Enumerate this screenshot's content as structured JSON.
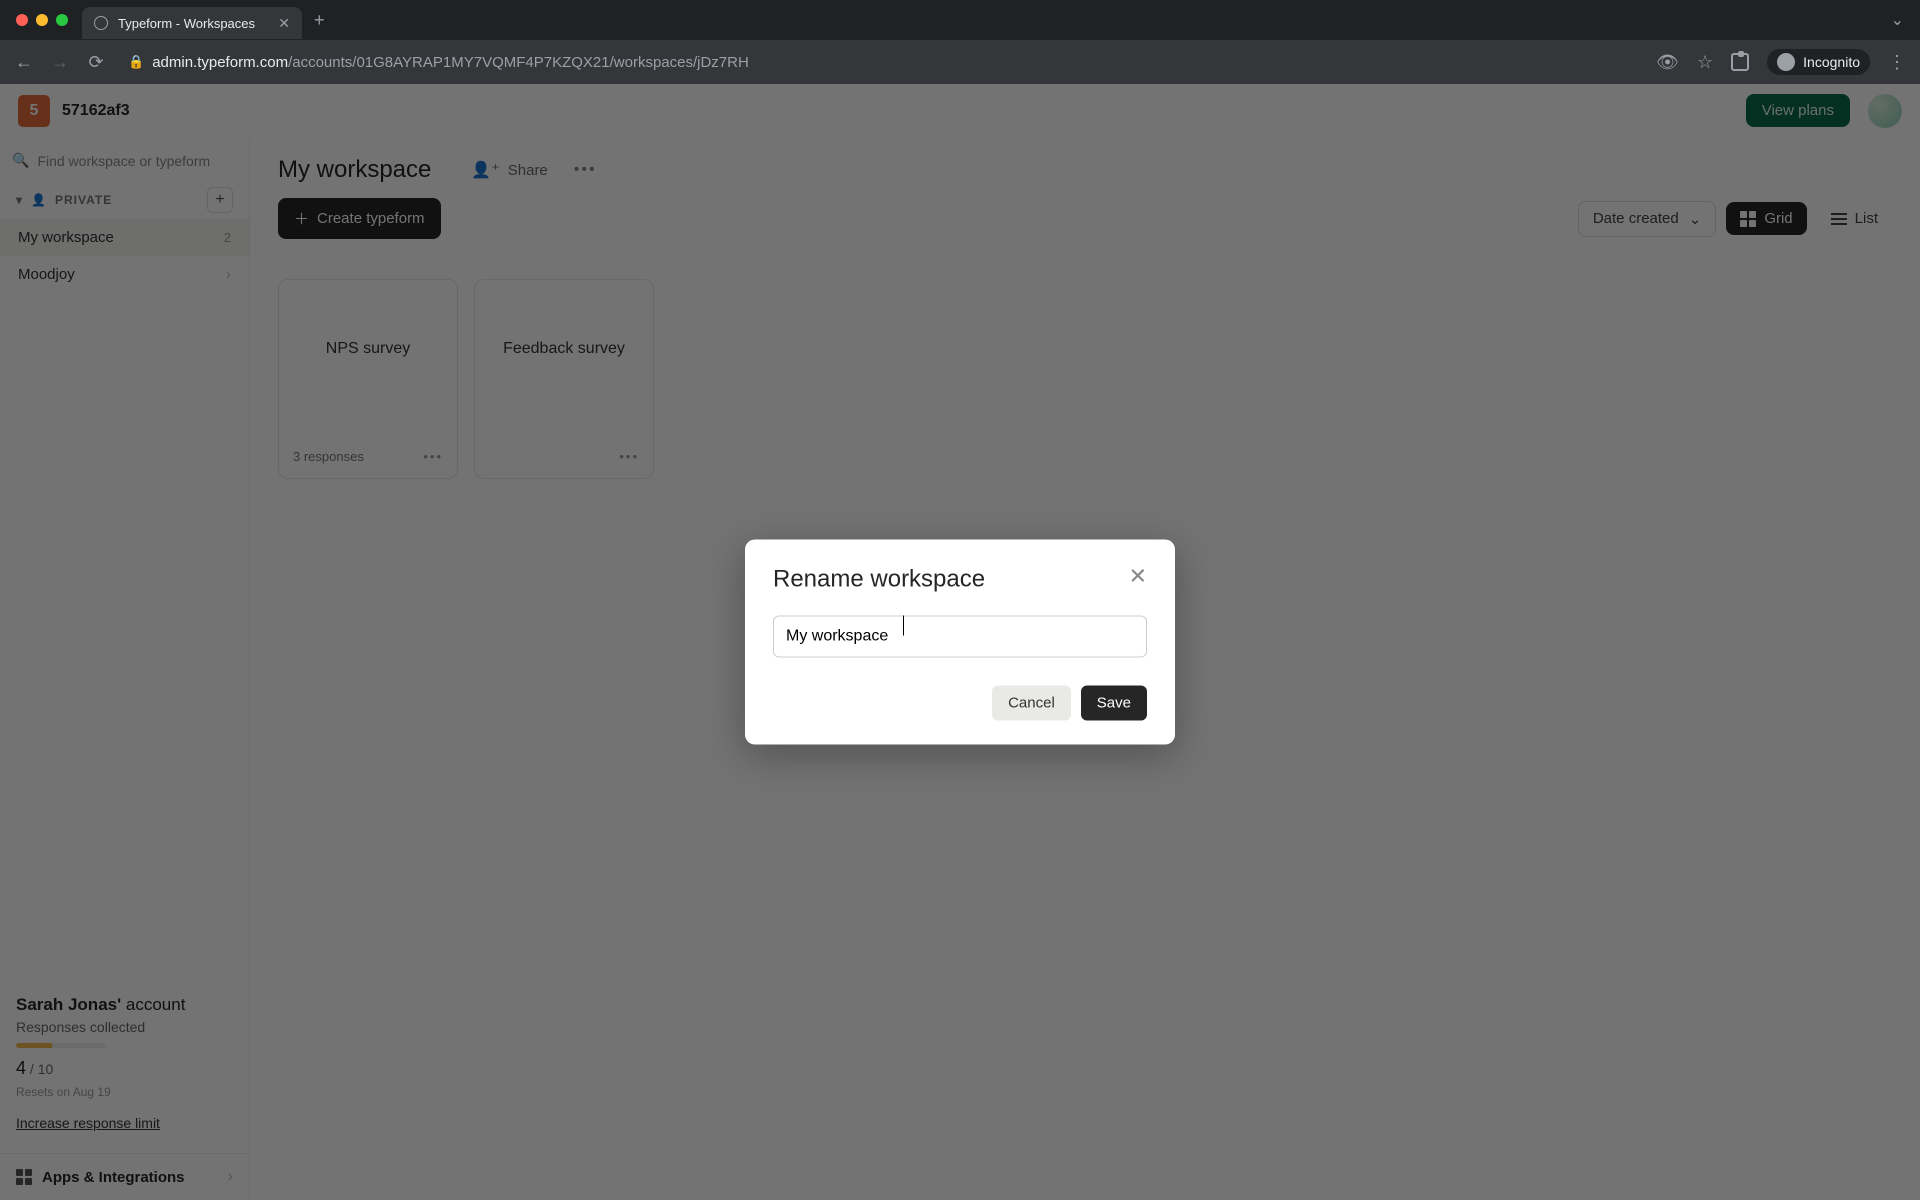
{
  "browser": {
    "tab_title": "Typeform - Workspaces",
    "url_host": "admin.typeform.com",
    "url_path": "/accounts/01G8AYRAP1MY7VQMF4P7KZQX21/workspaces/jDz7RH",
    "incognito_label": "Incognito"
  },
  "header": {
    "org_initial": "5",
    "org_name": "57162af3",
    "view_plans": "View plans"
  },
  "sidebar": {
    "search_placeholder": "Find workspace or typeform",
    "section_label": "PRIVATE",
    "items": [
      {
        "name": "My workspace",
        "meta": "2"
      },
      {
        "name": "Moodjoy",
        "meta": "›"
      }
    ],
    "account_owner": "Sarah Jonas'",
    "account_word": " account",
    "responses_label": "Responses collected",
    "responses_current": "4",
    "responses_sep": " / ",
    "responses_limit": "10",
    "reset_text": "Resets on Aug 19",
    "increase_text": "Increase response limit",
    "apps_label": "Apps & Integrations"
  },
  "main": {
    "workspace_title": "My workspace",
    "share_label": "Share",
    "create_label": "Create typeform",
    "sort_label": "Date created",
    "grid_label": "Grid",
    "list_label": "List",
    "cards": [
      {
        "title": "NPS survey",
        "footer": "3 responses"
      },
      {
        "title": "Feedback survey",
        "footer": ""
      }
    ]
  },
  "modal": {
    "title": "Rename workspace",
    "input_value": "My workspace",
    "cancel": "Cancel",
    "save": "Save"
  }
}
